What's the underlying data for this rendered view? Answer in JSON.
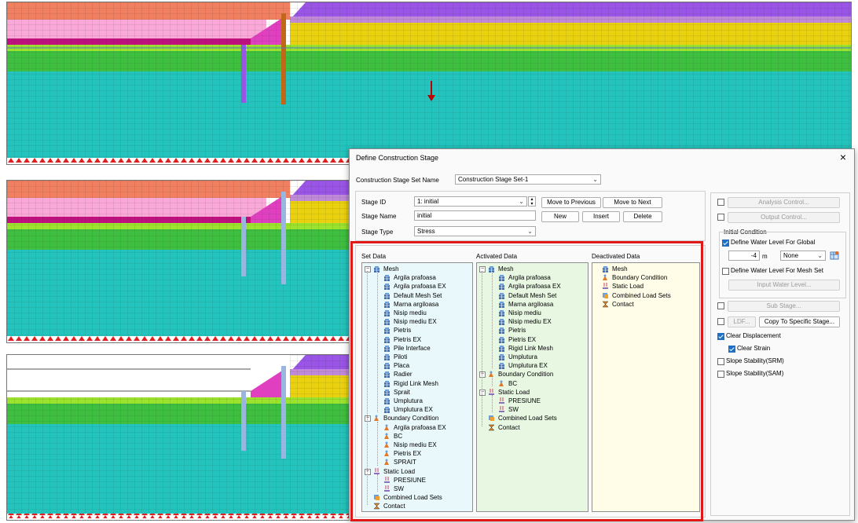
{
  "colors": {
    "mesh_orange": "#f08060",
    "mesh_pink": "#f9a8d8",
    "mesh_magenta": "#c01080",
    "mesh_lime": "#9be32d",
    "mesh_green": "#3fbf3f",
    "mesh_cyan": "#23c4bd",
    "mesh_yellow": "#ead10f",
    "mesh_purple": "#9a55e6",
    "highlight_red": "#e01818",
    "check_blue": "#1f6fc4",
    "set_panel_bg": "#e9f8fb",
    "activated_panel_bg": "#e7f7e2",
    "deactivated_panel_bg": "#fffde8"
  },
  "dialog": {
    "title": "Define Construction Stage",
    "close_icon": "×",
    "set_name_label": "Construction Stage Set Name",
    "set_name_value": "Construction Stage Set-1",
    "stage_id_label": "Stage ID",
    "stage_id_value": "1: initial",
    "stage_name_label": "Stage Name",
    "stage_name_value": "initial",
    "stage_type_label": "Stage Type",
    "stage_type_value": "Stress",
    "buttons": {
      "move_previous": "Move to Previous",
      "move_next": "Move to Next",
      "new": "New",
      "insert": "Insert",
      "delete": "Delete"
    },
    "set_data": {
      "title": "Set Data",
      "mesh_label": "Mesh",
      "mesh_items": [
        "Argila prafoasa",
        "Argila prafoasa EX",
        "Default Mesh Set",
        "Marna argiloasa",
        "Nisip mediu",
        "Nisip mediu EX",
        "Pietris",
        "Pietris EX",
        "Pile Interface",
        "Piloti",
        "Placa",
        "Radier",
        "Rigid Link Mesh",
        "Sprait",
        "Umplutura",
        "Umplutura EX"
      ],
      "bc_label": "Boundary Condition",
      "bc_items": [
        "Argila prafoasa EX",
        "BC",
        "Nisip mediu EX",
        "Pietris EX",
        "SPRAIT"
      ],
      "sl_label": "Static Load",
      "sl_items": [
        "PRESIUNE",
        "SW"
      ],
      "combined_label": "Combined Load Sets",
      "contact_label": "Contact"
    },
    "activated_data": {
      "title": "Activated Data",
      "mesh_label": "Mesh",
      "mesh_items": [
        "Argila prafoasa",
        "Argila prafoasa EX",
        "Default Mesh Set",
        "Marna argiloasa",
        "Nisip mediu",
        "Nisip mediu EX",
        "Pietris",
        "Pietris EX",
        "Rigid Link Mesh",
        "Umplutura",
        "Umplutura EX"
      ],
      "bc_label": "Boundary Condition",
      "bc_items": [
        "BC"
      ],
      "sl_label": "Static Load",
      "sl_items": [
        "PRESIUNE",
        "SW"
      ],
      "combined_label": "Combined Load Sets",
      "contact_label": "Contact"
    },
    "deactivated_data": {
      "title": "Deactivated Data",
      "items": [
        "Mesh",
        "Boundary Condition",
        "Static Load",
        "Combined Load Sets",
        "Contact"
      ]
    },
    "right": {
      "analysis_control": "Analysis Control...",
      "output_control": "Output Control...",
      "initial_condition": "Initial Condition",
      "define_water_global": "Define Water Level For Global",
      "water_level_value": "-4",
      "water_unit": "m",
      "water_func_value": "None",
      "define_water_mesh": "Define Water Level For Mesh Set",
      "input_water_level": "Input Water Level...",
      "sub_stage": "Sub Stage...",
      "ldf": "LDF...",
      "copy_stage": "Copy To Specific Stage...",
      "clear_displacement": "Clear Displacement",
      "clear_strain": "Clear Strain",
      "slope_srm": "Slope Stability(SRM)",
      "slope_sam": "Slope Stability(SAM)"
    }
  }
}
